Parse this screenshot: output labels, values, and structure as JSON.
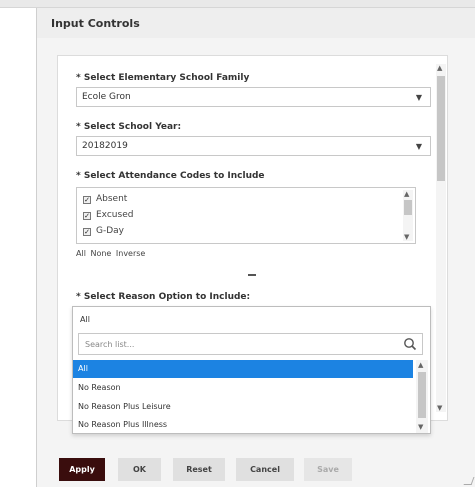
{
  "dialog": {
    "title": "Input Controls"
  },
  "controls": {
    "school_family": {
      "label": "* Select Elementary School Family",
      "value": "Ecole Gron"
    },
    "school_year": {
      "label": "* Select School Year:",
      "value": "20182019"
    },
    "attendance_codes": {
      "label": "* Select Attendance Codes to Include",
      "items": [
        {
          "label": "Absent",
          "checked": true
        },
        {
          "label": "Excused",
          "checked": true
        },
        {
          "label": "G-Day",
          "checked": true
        }
      ],
      "links": [
        "All",
        "None",
        "Inverse"
      ]
    },
    "reason_option": {
      "label": "* Select Reason Option to Include:",
      "value": "All",
      "search_placeholder": "Search list...",
      "options": [
        "All",
        "No Reason",
        "No Reason Plus Leisure",
        "No Reason Plus Illness"
      ],
      "selected_index": 0
    }
  },
  "icons": {
    "caret": "chevron-down-icon",
    "search": "search-icon",
    "check": "checkbox-icon"
  },
  "footer": {
    "apply": "Apply",
    "ok": "OK",
    "reset": "Reset",
    "cancel": "Cancel",
    "save": "Save"
  },
  "colors": {
    "primary_button": "#3a0d0d",
    "selected_option": "#1c83e2"
  }
}
